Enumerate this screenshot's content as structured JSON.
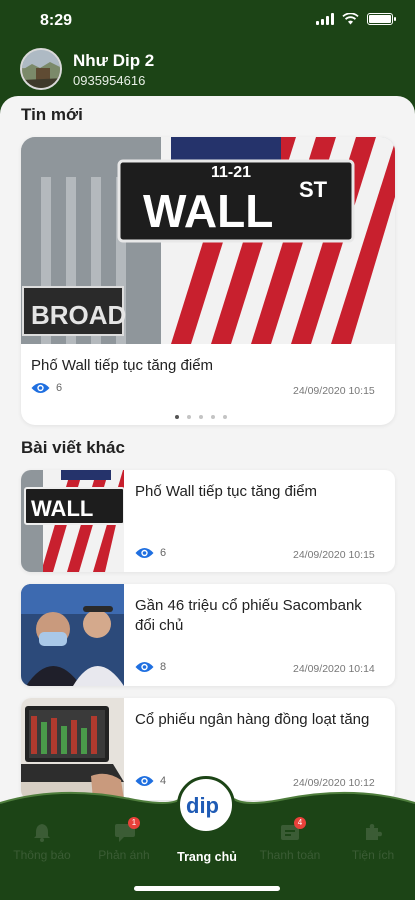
{
  "status": {
    "time": "8:29"
  },
  "user": {
    "name": "Như Dip 2",
    "phone": "0935954616"
  },
  "sections": {
    "latest": "Tin mới",
    "other": "Bài viết khác"
  },
  "featured": {
    "title": "Phố Wall tiếp tục tăng điểm",
    "views": "6",
    "date": "24/09/2020 10:15",
    "sign_main": "WALL",
    "sign_st": "ST",
    "sign_num": "11-21",
    "sign_street": "BROAD"
  },
  "articles": [
    {
      "title": "Phố Wall tiếp tục tăng điểm",
      "views": "6",
      "date": "24/09/2020 10:15",
      "sign": "WALL"
    },
    {
      "title": "Gần 46 triệu cổ phiếu Sacombank đổi chủ",
      "views": "8",
      "date": "24/09/2020 10:14"
    },
    {
      "title": "Cổ phiếu ngân hàng đồng loạt tăng",
      "views": "4",
      "date": "24/09/2020 10:12"
    }
  ],
  "nav": {
    "items": [
      {
        "label": "Thông báo"
      },
      {
        "label": "Phản ánh",
        "badge": "1"
      },
      {
        "label": "Thanh toán",
        "badge": "4"
      },
      {
        "label": "Tiện ích"
      }
    ],
    "center_label": "Trang chủ",
    "logo_text": "dip"
  },
  "colors": {
    "brand_green": "#1c4416",
    "badge_red": "#e8413a",
    "eye_blue": "#1f6fe0"
  }
}
